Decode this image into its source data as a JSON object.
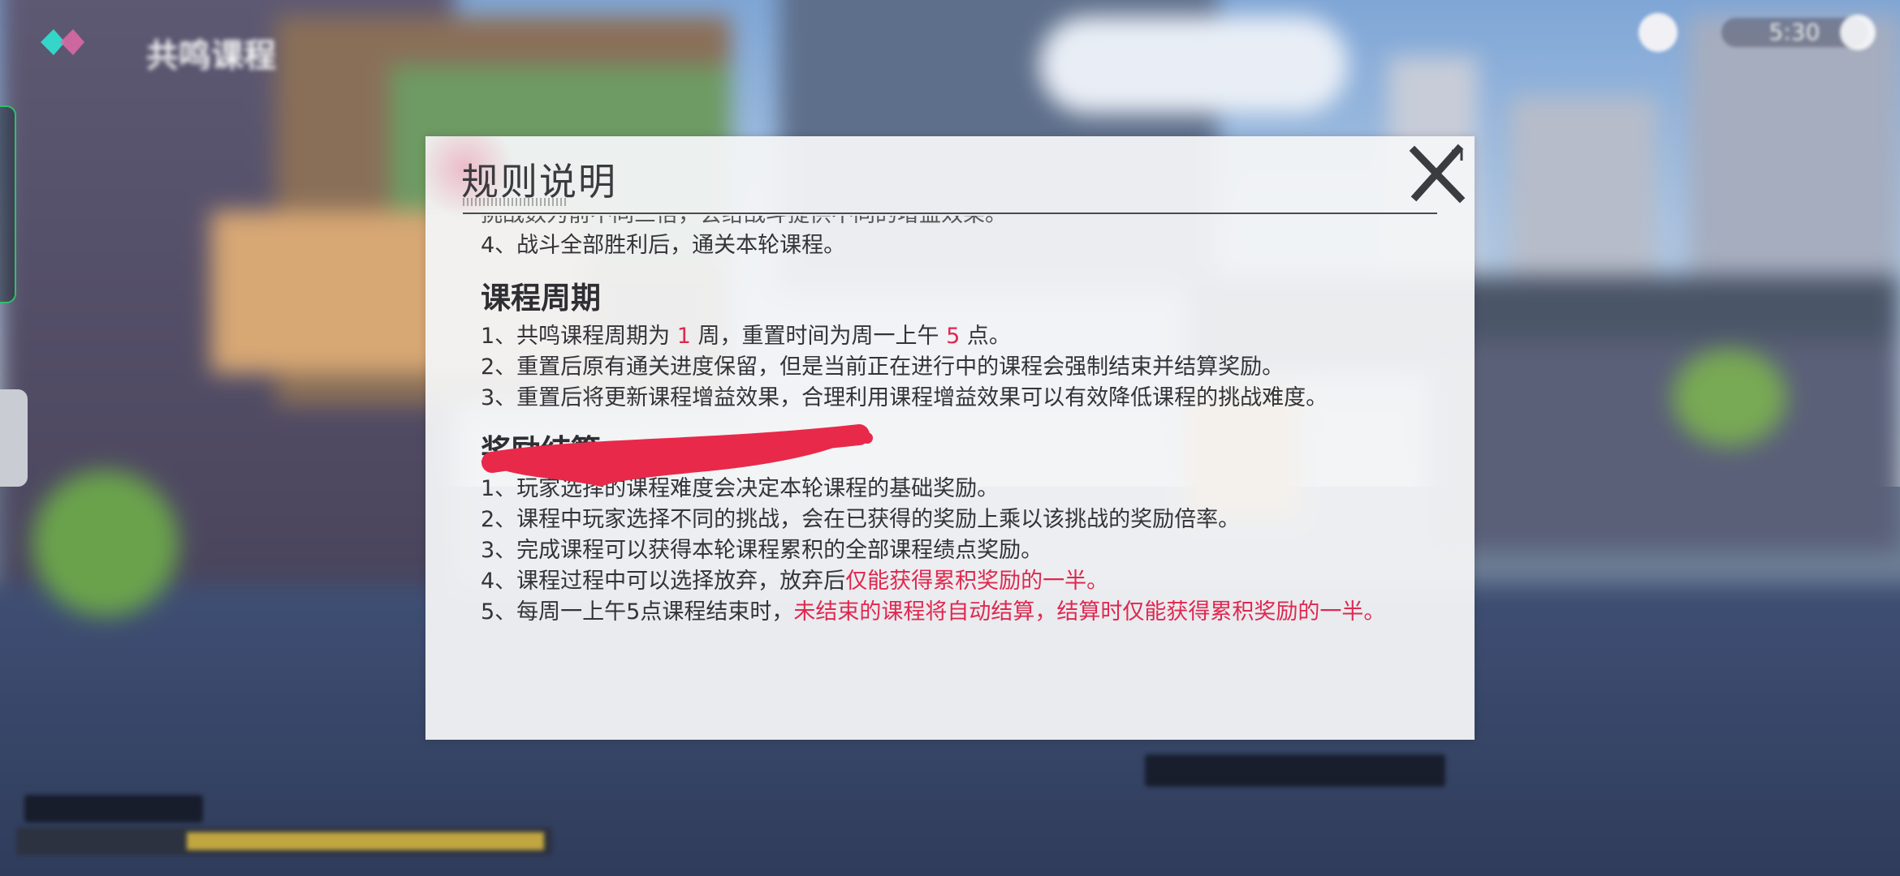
{
  "hud": {
    "title": "共鸣课程",
    "time": "5:30"
  },
  "modal": {
    "title": "规则说明",
    "close_icon": "close-x-icon",
    "top_lines": [
      "挑战数为前不同三倍，会给战斗提供不同的增益效果。",
      "4、战斗全部胜利后，通关本轮课程。"
    ],
    "cycle": {
      "heading": "课程周期",
      "line1": {
        "a": "1、共鸣课程周期为 ",
        "n1": "1",
        "b": " 周，重置时间为周一上午 ",
        "n2": "5",
        "c": " 点。"
      },
      "line2": "2、重置后原有通关进度保留，但是当前正在进行中的课程会强制结束并结算奖励。",
      "line3": "3、重置后将更新课程增益效果，合理利用课程增益效果可以有效降低课程的挑战难度。"
    },
    "reward": {
      "heading": "奖励结算",
      "line1": "1、玩家选择的课程难度会决定本轮课程的基础奖励。",
      "line2": "2、课程中玩家选择不同的挑战，会在已获得的奖励上乘以该挑战的奖励倍率。",
      "line3": "3、完成课程可以获得本轮课程累积的全部课程绩点奖励。",
      "line4": {
        "a": "4、课程过程中可以选择放弃，放弃后",
        "red": "仅能获得累积奖励的一半。"
      },
      "line5": {
        "a": "5、每周一上午5点课程结束时，",
        "red": "未结束的课程将自动结算，结算时仅能获得累积奖励的一半。"
      }
    }
  },
  "colors": {
    "accent_red": "#e0284f",
    "scribble": "#e8294a"
  }
}
